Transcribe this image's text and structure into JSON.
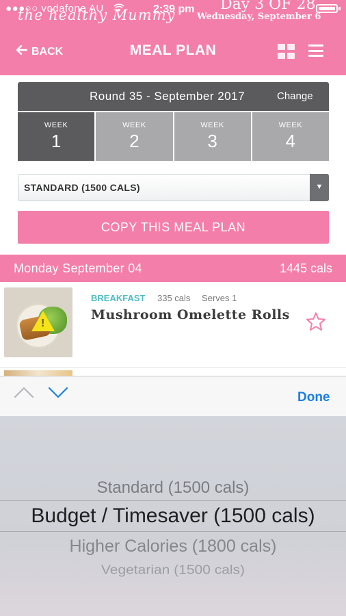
{
  "status_bar": {
    "carrier": "●●●○○ vodafone AU",
    "brand": "the healthy Mummy",
    "time": "2:39 pm",
    "day_overlay": "Day 3 OF 28",
    "date_overlay": "Wednesday, September 6"
  },
  "nav": {
    "back_label": "BACK",
    "title": "MEAL PLAN"
  },
  "round": {
    "label": "Round 35 - September 2017",
    "change_label": "Change"
  },
  "weeks": [
    {
      "label": "WEEK",
      "number": "1",
      "active": true
    },
    {
      "label": "WEEK",
      "number": "2",
      "active": false
    },
    {
      "label": "WEEK",
      "number": "3",
      "active": false
    },
    {
      "label": "WEEK",
      "number": "4",
      "active": false
    }
  ],
  "plan_select": {
    "value": "STANDARD (1500 CALS)"
  },
  "copy_button_label": "COPY THIS MEAL PLAN",
  "day": {
    "name": "Monday September 04",
    "total_cals": "1445 cals"
  },
  "meal": {
    "type": "BREAKFAST",
    "cals": "335 cals",
    "serves": "Serves 1",
    "name": "Mushroom Omelette Rolls"
  },
  "accessory": {
    "done_label": "Done"
  },
  "picker": {
    "options": [
      "Standard (1500 cals)",
      "Budget / Timesaver (1500 cals)",
      "Higher Calories (1800 cals)",
      "Vegetarian (1500 cals)"
    ],
    "selected": "Budget / Timesaver (1500 cals)"
  },
  "colors": {
    "brand_pink": "#f47eaa",
    "dark_grey": "#5b5b5e",
    "week_grey": "#a9a9ab",
    "teal": "#4fbcc4",
    "ios_blue": "#1a7fe3"
  }
}
